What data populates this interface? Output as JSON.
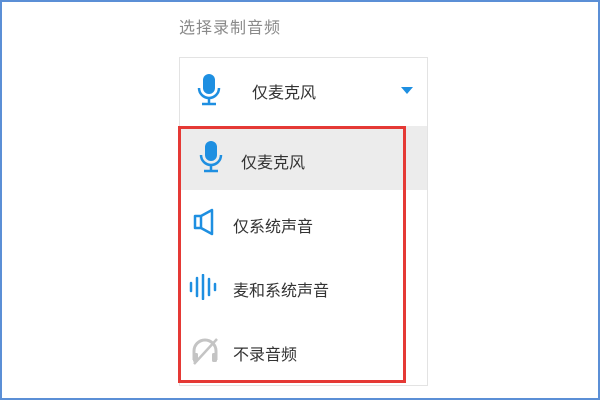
{
  "section": {
    "title": "选择录制音频"
  },
  "select": {
    "selected_label": "仅麦克风",
    "selected_icon": "microphone-icon",
    "caret_icon": "caret-down-icon"
  },
  "options": [
    {
      "label": "仅麦克风",
      "icon": "microphone-icon",
      "hovered": true
    },
    {
      "label": "仅系统声音",
      "icon": "speaker-icon",
      "hovered": false
    },
    {
      "label": "麦和系统声音",
      "icon": "sound-wave-icon",
      "hovered": false
    },
    {
      "label": "不录音频",
      "icon": "audio-off-icon",
      "hovered": false
    }
  ],
  "colors": {
    "accent": "#1e8fe1",
    "highlight_border": "#e53935",
    "hover_bg": "#ececec",
    "disabled_icon": "#c4c4c4",
    "frame_border": "#5b8fd6"
  }
}
